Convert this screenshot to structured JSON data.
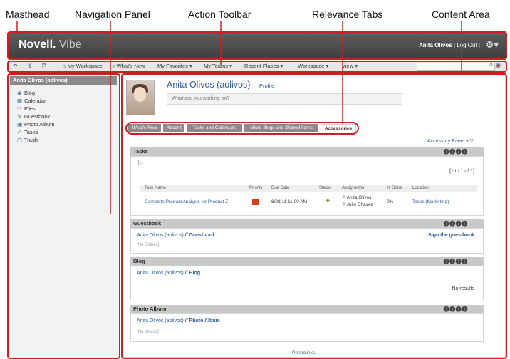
{
  "callouts": {
    "masthead": "Masthead",
    "navigation_panel": "Navigation Panel",
    "action_toolbar": "Action Toolbar",
    "relevance_tabs": "Relevance Tabs",
    "content_area": "Content Area"
  },
  "masthead": {
    "brand": "Novell.",
    "product": "Vibe",
    "user_name": "Anita Olivos",
    "logout": "Log Out",
    "separator": "|"
  },
  "toolbar": {
    "items": [
      "My Workspace",
      "What's New",
      "My Favorites",
      "My Teams",
      "Recent Places",
      "Workspace",
      "View"
    ]
  },
  "sidebar": {
    "title": "Anita Olivos (aolivos)",
    "items": [
      {
        "label": "Blog",
        "icon": "blog-icon"
      },
      {
        "label": "Calendar",
        "icon": "calendar-icon"
      },
      {
        "label": "Files",
        "icon": "files-icon"
      },
      {
        "label": "Guestbook",
        "icon": "guestbook-icon"
      },
      {
        "label": "Photo Album",
        "icon": "photo-icon"
      },
      {
        "label": "Tasks",
        "icon": "tasks-icon"
      },
      {
        "label": "Trash",
        "icon": "trash-icon"
      }
    ]
  },
  "profile": {
    "name": "Anita Olivos (aolivos)",
    "profile_link": "Profile",
    "status_placeholder": "What are you working on?"
  },
  "tabs": [
    "What's New",
    "Recent",
    "Tasks and Calendars",
    "Micro-Blogs and Shared Items",
    "Accessories"
  ],
  "accessory_panel": "Accessory Panel",
  "tasks": {
    "title": "Tasks",
    "paging": "[1 to 1 of 1]",
    "columns": [
      "Task Name",
      "Priority",
      "Due Date",
      "Status",
      "Assigned to",
      "% Done",
      "Location"
    ],
    "row": {
      "name": "Complete Product Analysis for Product Z",
      "due": "6/28/11 11:00 AM",
      "assigned1": "Anita Olivos",
      "assigned2": "Julio Chavez",
      "done": "0%",
      "location": "Tasks (Marketing)"
    }
  },
  "guestbook": {
    "title": "Guestbook",
    "owner": "Anita Olivos (aolivos)",
    "sep": "//",
    "name": "Guestbook",
    "sign": "Sign the guestbook",
    "empty": "[No Entries]"
  },
  "blog": {
    "title": "Blog",
    "owner": "Anita Olivos (aolivos)",
    "sep": "//",
    "name": "Blog",
    "no_results": "No results"
  },
  "photo": {
    "title": "Photo Album",
    "owner": "Anita Olivos (aolivos)",
    "sep": "//",
    "name": "Photo Album",
    "empty": "[No photos]"
  },
  "footer": {
    "permalinks": "Permalinks"
  }
}
